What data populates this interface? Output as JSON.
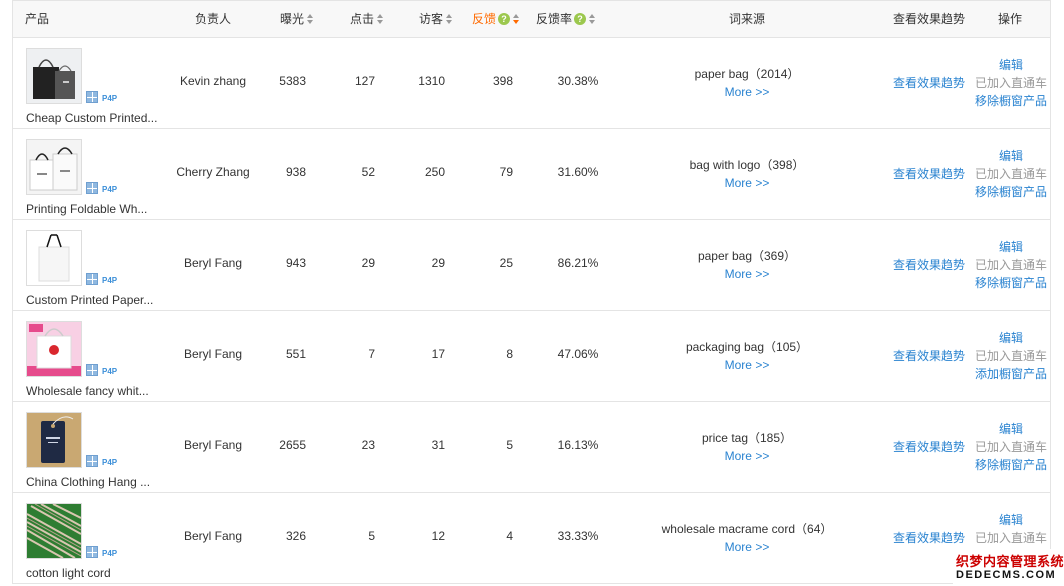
{
  "header": {
    "product": "产品",
    "owner": "负责人",
    "impressions": "曝光",
    "clicks": "点击",
    "visitors": "访客",
    "feedback": "反馈",
    "feedback_rate": "反馈率",
    "word_source": "词来源",
    "view_trend": "查看效果趋势",
    "actions": "操作",
    "help_glyph": "?"
  },
  "p4p_label": "P4P",
  "rows": [
    {
      "product_name": "Cheap Custom Printed...",
      "owner": "Kevin zhang",
      "impressions": "5383",
      "clicks": "127",
      "visitors": "1310",
      "feedback": "398",
      "feedback_rate": "30.38%",
      "keyword": "paper bag（2014）",
      "more": "More >>",
      "trend": "查看效果趋势",
      "edit": "编辑",
      "added": "已加入直通车",
      "window_action": "移除橱窗产品",
      "thumb": "black-bag"
    },
    {
      "product_name": "Printing Foldable Wh...",
      "owner": "Cherry Zhang",
      "impressions": "938",
      "clicks": "52",
      "visitors": "250",
      "feedback": "79",
      "feedback_rate": "31.60%",
      "keyword": "bag with logo（398）",
      "more": "More >>",
      "trend": "查看效果趋势",
      "edit": "编辑",
      "added": "已加入直通车",
      "window_action": "移除橱窗产品",
      "thumb": "white-bags"
    },
    {
      "product_name": "Custom Printed Paper...",
      "owner": "Beryl Fang",
      "impressions": "943",
      "clicks": "29",
      "visitors": "29",
      "feedback": "25",
      "feedback_rate": "86.21%",
      "keyword": "paper bag（369）",
      "more": "More >>",
      "trend": "查看效果趋势",
      "edit": "编辑",
      "added": "已加入直通车",
      "window_action": "移除橱窗产品",
      "thumb": "white-bag"
    },
    {
      "product_name": "Wholesale fancy whit...",
      "owner": "Beryl Fang",
      "impressions": "551",
      "clicks": "7",
      "visitors": "17",
      "feedback": "8",
      "feedback_rate": "47.06%",
      "keyword": "packaging bag（105）",
      "more": "More >>",
      "trend": "查看效果趋势",
      "edit": "编辑",
      "added": "已加入直通车",
      "window_action": "添加橱窗产品",
      "thumb": "pink-bag"
    },
    {
      "product_name": "China Clothing Hang ...",
      "owner": "Beryl Fang",
      "impressions": "2655",
      "clicks": "23",
      "visitors": "31",
      "feedback": "5",
      "feedback_rate": "16.13%",
      "keyword": "price tag（185）",
      "more": "More >>",
      "trend": "查看效果趋势",
      "edit": "编辑",
      "added": "已加入直通车",
      "window_action": "移除橱窗产品",
      "thumb": "hang-tag"
    },
    {
      "product_name": "cotton light cord",
      "owner": "Beryl Fang",
      "impressions": "326",
      "clicks": "5",
      "visitors": "12",
      "feedback": "4",
      "feedback_rate": "33.33%",
      "keyword": "wholesale macrame cord（64）",
      "more": "More >>",
      "trend": "查看效果趋势",
      "edit": "编辑",
      "added": "已加入直通车",
      "window_action": "",
      "thumb": "cord"
    }
  ],
  "watermark": {
    "line1": "织梦内容管理系统",
    "line2": "DEDECMS.COM"
  }
}
